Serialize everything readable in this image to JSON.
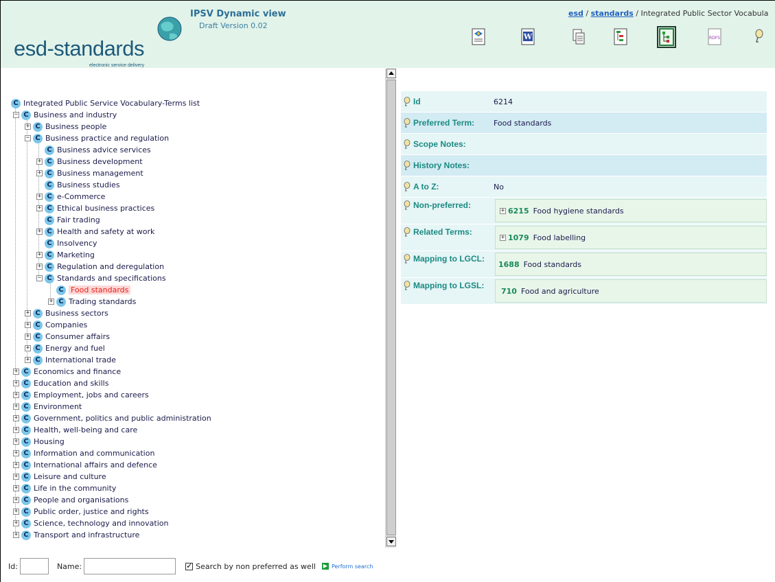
{
  "header": {
    "logo_text": "esd-standards",
    "logo_sub": "electronic service delivery",
    "title": "IPSV Dynamic view",
    "version": "Draft Version 0.02",
    "breadcrumb": {
      "link1": "esd",
      "sep": " / ",
      "link2": "standards",
      "current": "Integrated Public Sector Vocabula"
    },
    "toolbar": [
      "xml-export-icon",
      "word-export-icon",
      "copy-pages-icon",
      "hierarchy-icon",
      "tree-view-icon",
      "rdfs-icon",
      "help-bulb-icon"
    ]
  },
  "tree": {
    "root": "Integrated Public Service Vocabulary-Terms list",
    "items": [
      {
        "label": "Business and industry",
        "level": 1,
        "expanded": true
      },
      {
        "label": "Business people",
        "level": 2
      },
      {
        "label": "Business practice and regulation",
        "level": 2,
        "expanded": true
      },
      {
        "label": "Business advice services",
        "level": 3,
        "leaf": true
      },
      {
        "label": "Business development",
        "level": 3
      },
      {
        "label": "Business management",
        "level": 3
      },
      {
        "label": "Business studies",
        "level": 3,
        "leaf": true
      },
      {
        "label": "e-Commerce",
        "level": 3
      },
      {
        "label": "Ethical business practices",
        "level": 3
      },
      {
        "label": "Fair trading",
        "level": 3,
        "leaf": true
      },
      {
        "label": "Health and safety at work",
        "level": 3
      },
      {
        "label": "Insolvency",
        "level": 3,
        "leaf": true
      },
      {
        "label": "Marketing",
        "level": 3
      },
      {
        "label": "Regulation and deregulation",
        "level": 3
      },
      {
        "label": "Standards and specifications",
        "level": 3,
        "expanded": true
      },
      {
        "label": "Food standards",
        "level": 4,
        "leaf": true,
        "selected": true
      },
      {
        "label": "Trading standards",
        "level": 4
      },
      {
        "label": "Business sectors",
        "level": 2
      },
      {
        "label": "Companies",
        "level": 2
      },
      {
        "label": "Consumer affairs",
        "level": 2
      },
      {
        "label": "Energy and fuel",
        "level": 2
      },
      {
        "label": "International trade",
        "level": 2
      },
      {
        "label": "Economics and finance",
        "level": 1
      },
      {
        "label": "Education and skills",
        "level": 1
      },
      {
        "label": "Employment, jobs and careers",
        "level": 1
      },
      {
        "label": "Environment",
        "level": 1
      },
      {
        "label": "Government, politics and public administration",
        "level": 1
      },
      {
        "label": "Health, well-being and care",
        "level": 1
      },
      {
        "label": "Housing",
        "level": 1
      },
      {
        "label": "Information and communication",
        "level": 1
      },
      {
        "label": "International affairs and defence",
        "level": 1
      },
      {
        "label": "Leisure and culture",
        "level": 1
      },
      {
        "label": "Life in the community",
        "level": 1
      },
      {
        "label": "People and organisations",
        "level": 1
      },
      {
        "label": "Public order, justice and rights",
        "level": 1
      },
      {
        "label": "Science, technology and innovation",
        "level": 1
      },
      {
        "label": "Transport and infrastructure",
        "level": 1
      }
    ]
  },
  "search": {
    "id_label": "Id:",
    "name_label": "Name:",
    "id_value": "",
    "name_value": "",
    "checkbox_label": "Search by non preferred as well",
    "checkbox_checked": true,
    "button_label": "Perform search"
  },
  "details": {
    "id_label": "Id",
    "id_value": "6214",
    "preferred_label": "Preferred Term:",
    "preferred_value": "Food standards",
    "scope_label": "Scope Notes:",
    "history_label": "History Notes:",
    "atoz_label": "A to Z:",
    "atoz_value": "No",
    "nonpref_label": "Non-preferred:",
    "nonpref_num": "6215",
    "nonpref_text": "Food hygiene standards",
    "related_label": "Related Terms:",
    "related_num": "1079",
    "related_text": "Food labelling",
    "lgcl_label": "Mapping to LGCL:",
    "lgcl_num": "1688",
    "lgcl_text": "Food standards",
    "lgsl_label": "Mapping to LGSL:",
    "lgsl_num": "710",
    "lgsl_text": "Food and agriculture"
  },
  "colors": {
    "header_bg": "#e2f3ea",
    "label_teal": "#1a8a82",
    "row_light": "#e6f5f6",
    "row_dark": "#d3ebf3",
    "selected_red": "#e8231b"
  }
}
